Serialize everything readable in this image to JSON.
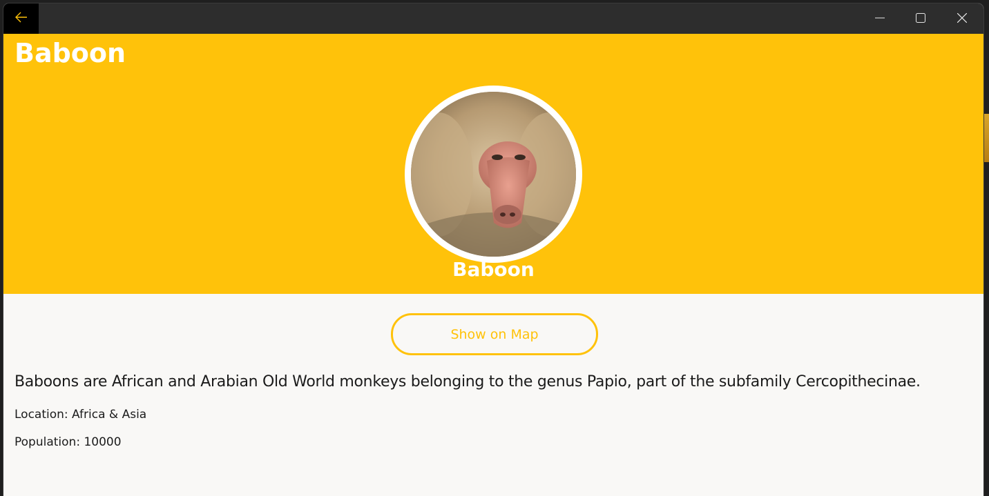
{
  "window": {
    "controls": {
      "back_icon": "arrow-left-icon",
      "minimize_icon": "minimize-icon",
      "maximize_icon": "maximize-icon",
      "close_icon": "close-icon"
    }
  },
  "header": {
    "title": "Baboon",
    "image_subject": "baboon-photo",
    "avatar_name": "Baboon"
  },
  "actions": {
    "map_label": "Show on Map"
  },
  "details": {
    "description": "Baboons are African and Arabian Old World monkeys belonging to the genus Papio, part of the subfamily Cercopithecinae.",
    "location": "Location: Africa & Asia",
    "population": "Population: 10000"
  },
  "colors": {
    "accent": "#ffc20a",
    "titlebar": "#2d2d2d",
    "content_bg": "#f9f8f6"
  }
}
